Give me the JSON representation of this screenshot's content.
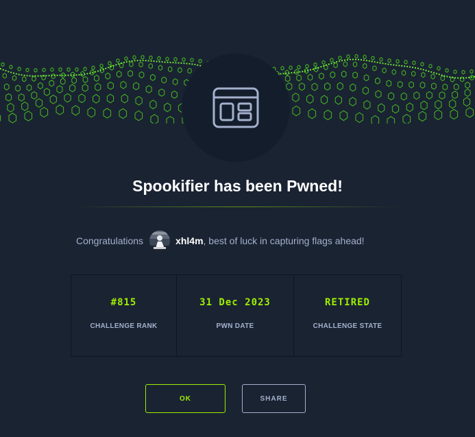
{
  "modal": {
    "title": "Spookifier has been Pwned!",
    "congrats_prefix": "Congratulations",
    "username": "xhl4m",
    "congrats_suffix": ", best of luck in capturing flags ahead!",
    "app_icon": "web-app-window-icon",
    "avatar_icon": "user-avatar"
  },
  "stats": [
    {
      "value": "#815",
      "label": "CHALLENGE RANK"
    },
    {
      "value": "31 Dec 2023",
      "label": "PWN DATE"
    },
    {
      "value": "RETIRED",
      "label": "CHALLENGE STATE"
    }
  ],
  "buttons": {
    "ok_label": "OK",
    "share_label": "SHARE"
  },
  "colors": {
    "background": "#1a2332",
    "accent": "#9fef00",
    "muted_text": "#a4b1cd",
    "icon_circle": "#141d2b"
  }
}
